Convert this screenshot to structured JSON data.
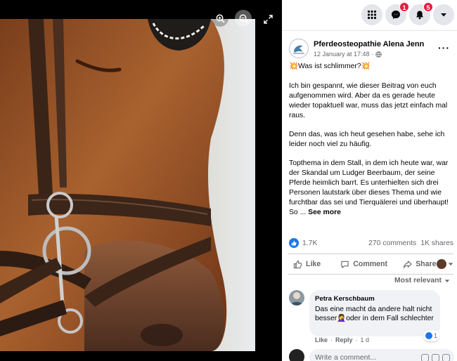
{
  "topbar": {
    "messenger_badge": "1",
    "notifications_badge": "5"
  },
  "post": {
    "page_name": "Pferdeosteopathie Alena Jenn",
    "date": "12 January at 17:48 ·",
    "title": "💥Was ist schlimmer?💥",
    "paragraph_1": "Ich bin gespannt, wie dieser Beitrag von euch aufgenommen wird. Aber da es gerade heute wieder topaktuell war, muss das jetzt einfach mal raus.",
    "paragraph_2": "Denn das, was ich heut gesehen habe, sehe ich leider noch viel zu häufig.",
    "paragraph_3": "Topthema in dem Stall, in dem ich heute war, war der Skandal um Ludger Beerbaum, der seine Pferde heimlich barrt. Es unterhielten sich drei Personen lautstark über dieses Thema und wie furchtbar das sei und Tierquälerei und überhaupt! So ...",
    "see_more": "See more"
  },
  "stats": {
    "reactions": "1.7K",
    "comments": "270 comments",
    "shares": "1K shares"
  },
  "actions": {
    "like": "Like",
    "comment": "Comment",
    "share": "Share"
  },
  "comments": {
    "sort_label": "Most relevant",
    "items": [
      {
        "author": "Petra Kerschbaum",
        "text": "Das eine macht da andere halt nicht besser🤦‍♀️oder in dem Fall schlechter",
        "reaction_count": "1",
        "like": "Like",
        "reply": "Reply",
        "age": "1 d"
      }
    ],
    "composer_placeholder": "Write a comment..."
  },
  "colors": {
    "accent": "#1877f2",
    "badge": "#e41e3f",
    "secondary_text": "#65676b",
    "bubble_bg": "#f0f2f5"
  },
  "icons": [
    "zoom-in-icon",
    "zoom-out-icon",
    "fullscreen-icon",
    "menu-grid-icon",
    "messenger-icon",
    "bell-icon",
    "caret-down-icon",
    "globe-icon",
    "more-icon",
    "like-icon",
    "comment-icon",
    "share-icon"
  ]
}
